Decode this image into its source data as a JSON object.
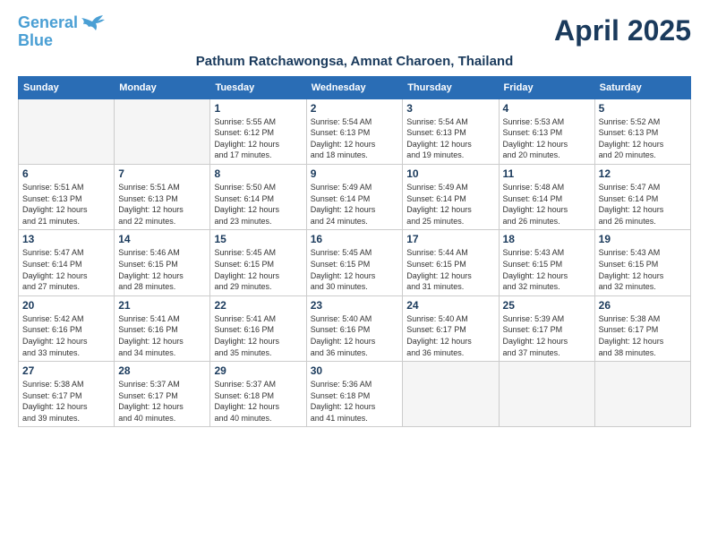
{
  "logo": {
    "line1": "General",
    "line2": "Blue"
  },
  "title": "April 2025",
  "location": "Pathum Ratchawongsa, Amnat Charoen, Thailand",
  "weekdays": [
    "Sunday",
    "Monday",
    "Tuesday",
    "Wednesday",
    "Thursday",
    "Friday",
    "Saturday"
  ],
  "days": [
    {
      "date": "",
      "info": ""
    },
    {
      "date": "",
      "info": ""
    },
    {
      "date": "1",
      "sunrise": "5:55 AM",
      "sunset": "6:12 PM",
      "daylight": "12 hours and 17 minutes."
    },
    {
      "date": "2",
      "sunrise": "5:54 AM",
      "sunset": "6:13 PM",
      "daylight": "12 hours and 18 minutes."
    },
    {
      "date": "3",
      "sunrise": "5:54 AM",
      "sunset": "6:13 PM",
      "daylight": "12 hours and 19 minutes."
    },
    {
      "date": "4",
      "sunrise": "5:53 AM",
      "sunset": "6:13 PM",
      "daylight": "12 hours and 20 minutes."
    },
    {
      "date": "5",
      "sunrise": "5:52 AM",
      "sunset": "6:13 PM",
      "daylight": "12 hours and 20 minutes."
    },
    {
      "date": "6",
      "sunrise": "5:51 AM",
      "sunset": "6:13 PM",
      "daylight": "12 hours and 21 minutes."
    },
    {
      "date": "7",
      "sunrise": "5:51 AM",
      "sunset": "6:13 PM",
      "daylight": "12 hours and 22 minutes."
    },
    {
      "date": "8",
      "sunrise": "5:50 AM",
      "sunset": "6:14 PM",
      "daylight": "12 hours and 23 minutes."
    },
    {
      "date": "9",
      "sunrise": "5:49 AM",
      "sunset": "6:14 PM",
      "daylight": "12 hours and 24 minutes."
    },
    {
      "date": "10",
      "sunrise": "5:49 AM",
      "sunset": "6:14 PM",
      "daylight": "12 hours and 25 minutes."
    },
    {
      "date": "11",
      "sunrise": "5:48 AM",
      "sunset": "6:14 PM",
      "daylight": "12 hours and 26 minutes."
    },
    {
      "date": "12",
      "sunrise": "5:47 AM",
      "sunset": "6:14 PM",
      "daylight": "12 hours and 26 minutes."
    },
    {
      "date": "13",
      "sunrise": "5:47 AM",
      "sunset": "6:14 PM",
      "daylight": "12 hours and 27 minutes."
    },
    {
      "date": "14",
      "sunrise": "5:46 AM",
      "sunset": "6:15 PM",
      "daylight": "12 hours and 28 minutes."
    },
    {
      "date": "15",
      "sunrise": "5:45 AM",
      "sunset": "6:15 PM",
      "daylight": "12 hours and 29 minutes."
    },
    {
      "date": "16",
      "sunrise": "5:45 AM",
      "sunset": "6:15 PM",
      "daylight": "12 hours and 30 minutes."
    },
    {
      "date": "17",
      "sunrise": "5:44 AM",
      "sunset": "6:15 PM",
      "daylight": "12 hours and 31 minutes."
    },
    {
      "date": "18",
      "sunrise": "5:43 AM",
      "sunset": "6:15 PM",
      "daylight": "12 hours and 32 minutes."
    },
    {
      "date": "19",
      "sunrise": "5:43 AM",
      "sunset": "6:15 PM",
      "daylight": "12 hours and 32 minutes."
    },
    {
      "date": "20",
      "sunrise": "5:42 AM",
      "sunset": "6:16 PM",
      "daylight": "12 hours and 33 minutes."
    },
    {
      "date": "21",
      "sunrise": "5:41 AM",
      "sunset": "6:16 PM",
      "daylight": "12 hours and 34 minutes."
    },
    {
      "date": "22",
      "sunrise": "5:41 AM",
      "sunset": "6:16 PM",
      "daylight": "12 hours and 35 minutes."
    },
    {
      "date": "23",
      "sunrise": "5:40 AM",
      "sunset": "6:16 PM",
      "daylight": "12 hours and 36 minutes."
    },
    {
      "date": "24",
      "sunrise": "5:40 AM",
      "sunset": "6:17 PM",
      "daylight": "12 hours and 36 minutes."
    },
    {
      "date": "25",
      "sunrise": "5:39 AM",
      "sunset": "6:17 PM",
      "daylight": "12 hours and 37 minutes."
    },
    {
      "date": "26",
      "sunrise": "5:38 AM",
      "sunset": "6:17 PM",
      "daylight": "12 hours and 38 minutes."
    },
    {
      "date": "27",
      "sunrise": "5:38 AM",
      "sunset": "6:17 PM",
      "daylight": "12 hours and 39 minutes."
    },
    {
      "date": "28",
      "sunrise": "5:37 AM",
      "sunset": "6:17 PM",
      "daylight": "12 hours and 40 minutes."
    },
    {
      "date": "29",
      "sunrise": "5:37 AM",
      "sunset": "6:18 PM",
      "daylight": "12 hours and 40 minutes."
    },
    {
      "date": "30",
      "sunrise": "5:36 AM",
      "sunset": "6:18 PM",
      "daylight": "12 hours and 41 minutes."
    },
    {
      "date": "",
      "info": ""
    },
    {
      "date": "",
      "info": ""
    },
    {
      "date": "",
      "info": ""
    },
    {
      "date": "",
      "info": ""
    }
  ],
  "labels": {
    "sunrise": "Sunrise:",
    "sunset": "Sunset:",
    "daylight": "Daylight:"
  }
}
